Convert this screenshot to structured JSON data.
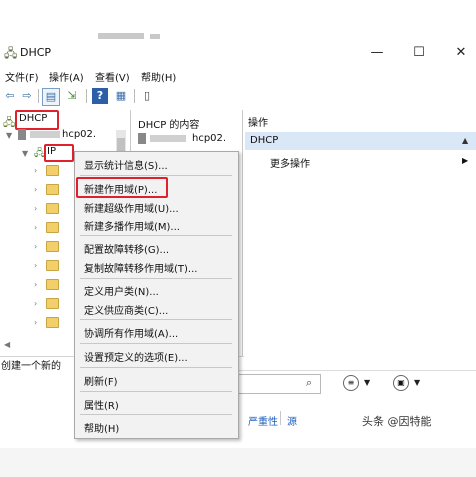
{
  "window": {
    "title": "DHCP",
    "minimize": "—",
    "maximize": "☐",
    "close": "✕"
  },
  "menu": [
    "文件(F)",
    "操作(A)",
    "查看(V)",
    "帮助(H)"
  ],
  "tree": {
    "root": "DHCP",
    "server": "hcp02.",
    "ipv4": "IP"
  },
  "content_header": "DHCP 的内容",
  "content_item": "hcp02.",
  "actions": {
    "header": "操作",
    "selected": "DHCP",
    "more": "更多操作"
  },
  "context_menu": [
    "显示统计信息(S)...",
    "新建作用域(P)...",
    "新建超级作用域(U)...",
    "新建多播作用域(M)...",
    "配置故障转移(G)...",
    "复制故障转移作用域(T)...",
    "定义用户类(N)...",
    "定义供应商类(C)...",
    "协调所有作用域(A)...",
    "设置预定义的选项(E)...",
    "刷新(F)",
    "属性(R)",
    "帮助(H)"
  ],
  "status_text": "创建一个新的",
  "lower": {
    "severity": "严重性",
    "source": "源"
  },
  "watermark": "头条 @因特能",
  "colors": {
    "highlight": "#e0202a",
    "action_selected": "#d9e7f6"
  }
}
